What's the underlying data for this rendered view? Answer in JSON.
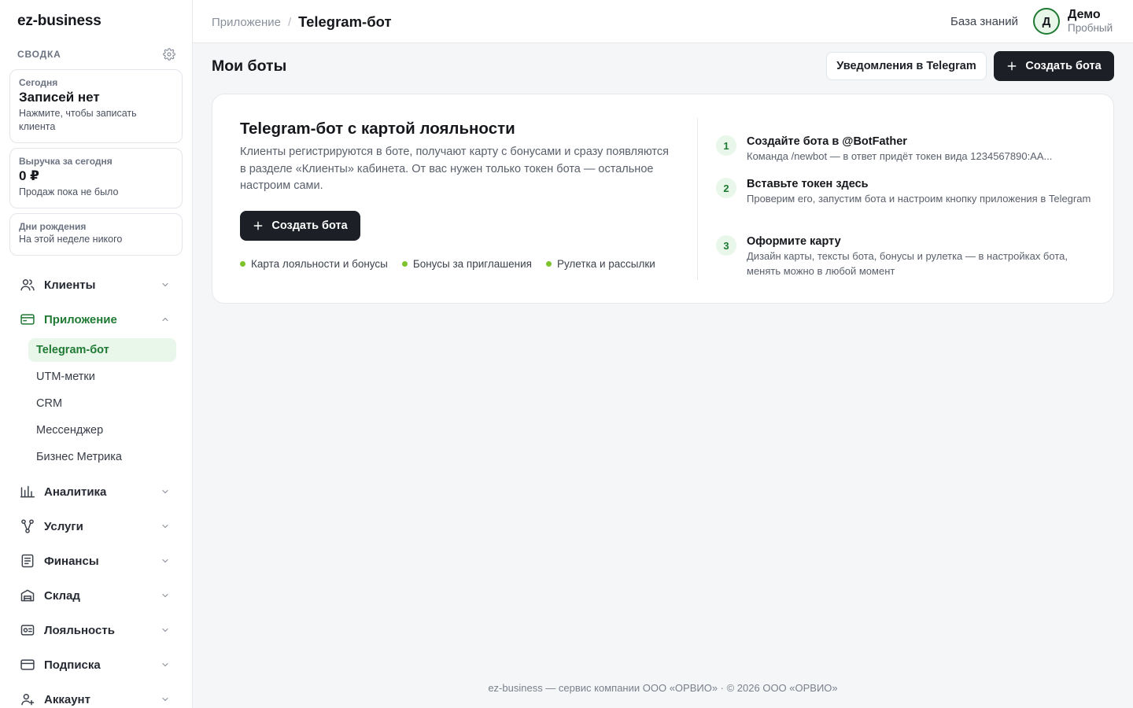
{
  "app": {
    "brand": "ez-business"
  },
  "sidebar": {
    "summary_title": "СВОДКА",
    "cards": [
      {
        "label": "Сегодня",
        "value": "Записей нет",
        "sub": "Нажмите, чтобы записать клиента"
      },
      {
        "label": "Выручка за сегодня",
        "value": "0 ₽",
        "sub": "Продаж пока не было"
      },
      {
        "label": "Дни рождения",
        "sub": "На этой неделе никого"
      }
    ],
    "nav": [
      {
        "label": "Клиенты",
        "icon": "users-icon"
      },
      {
        "label": "Приложение",
        "icon": "card-icon",
        "expanded": true,
        "children": [
          "Telegram-бот",
          "UTM-метки",
          "CRM",
          "Мессенджер",
          "Бизнес Метрика"
        ]
      },
      {
        "label": "Аналитика",
        "icon": "chart-icon"
      },
      {
        "label": "Услуги",
        "icon": "services-icon"
      },
      {
        "label": "Финансы",
        "icon": "finance-icon"
      },
      {
        "label": "Склад",
        "icon": "warehouse-icon"
      },
      {
        "label": "Лояльность",
        "icon": "loyalty-icon"
      },
      {
        "label": "Подписка",
        "icon": "subscription-icon"
      },
      {
        "label": "Аккаунт",
        "icon": "account-icon"
      }
    ]
  },
  "topbar": {
    "breadcrumb_parent": "Приложение",
    "breadcrumb_sep": "/",
    "breadcrumb_current": "Telegram-бот",
    "knowledge_base": "База знаний",
    "avatar_letter": "Д",
    "user_name": "Демо",
    "user_plan": "Пробный"
  },
  "main": {
    "title": "Мои боты",
    "notify_button": "Уведомления в Telegram",
    "create_button": "Создать бота",
    "panel": {
      "title": "Telegram-бот с картой лояльности",
      "description": "Клиенты регистрируются в боте, получают карту с бонусами и сразу появляются в разделе «Клиенты» кабинета. От вас нужен только токен бота — остальное настроим сами.",
      "create_button": "Создать бота",
      "features": [
        "Карта лояльности и бонусы",
        "Бонусы за приглашения",
        "Рулетка и рассылки"
      ],
      "steps": [
        {
          "num": "1",
          "title": "Создайте бота в @BotFather",
          "desc": "Команда /newbot — в ответ придёт токен вида 1234567890:AA..."
        },
        {
          "num": "2",
          "title": "Вставьте токен здесь",
          "desc": "Проверим его, запустим бота и настроим кнопку приложения в Telegram"
        },
        {
          "num": "3",
          "title": "Оформите карту",
          "desc": "Дизайн карты, тексты бота, бонусы и рулетка — в настройках бота, менять можно в любой момент"
        }
      ]
    }
  },
  "footer": {
    "text": "ez-business — сервис компании ООО «ОРВИО» · © 2026 ООО «ОРВИО»"
  },
  "colors": {
    "accent_green": "#1f7a34",
    "dark_button": "#1c1f26",
    "feature_dot": "#7ec32c"
  }
}
